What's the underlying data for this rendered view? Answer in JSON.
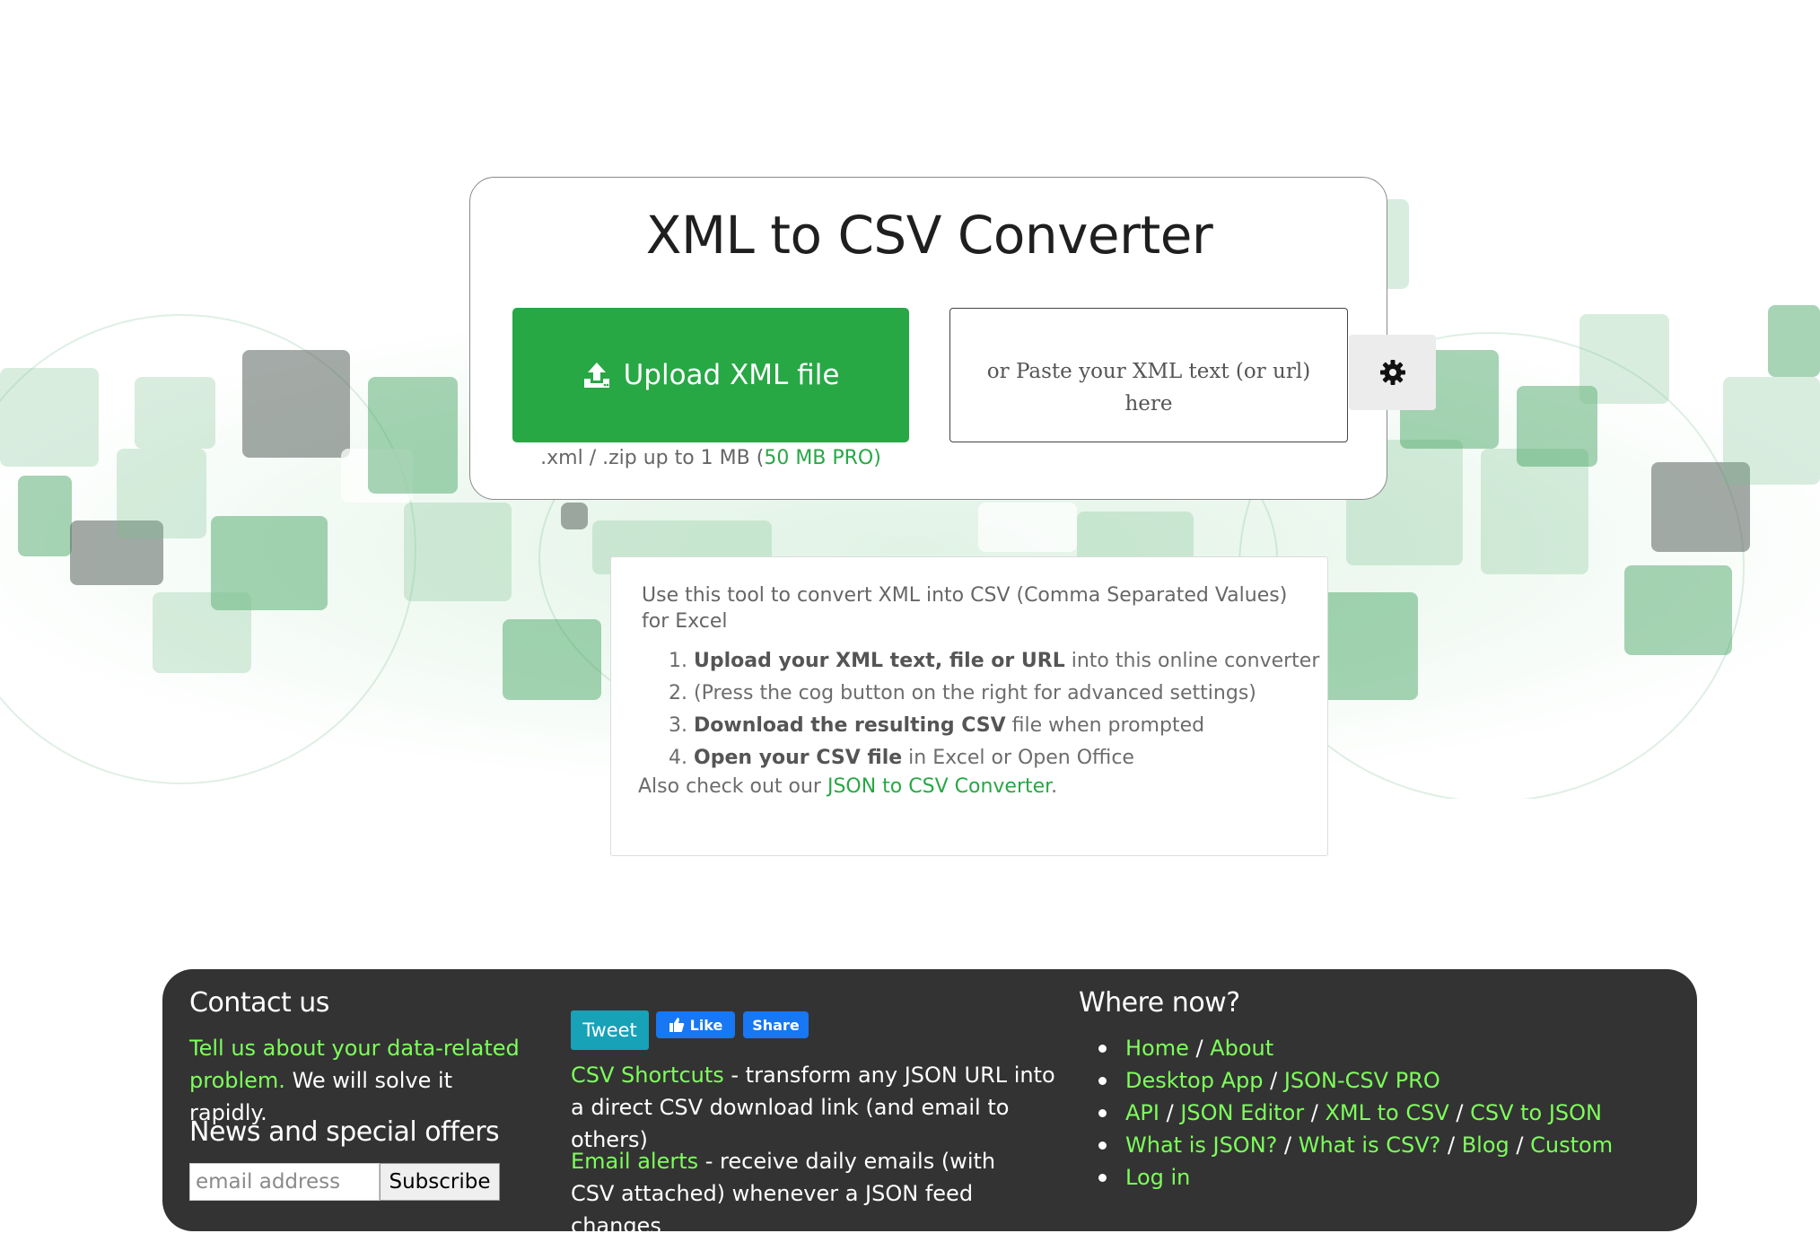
{
  "page": {
    "title": "XML to CSV Converter"
  },
  "converter": {
    "upload_label": "Upload XML file",
    "upload_note_prefix": ".xml / .zip up to 1 MB (",
    "upload_note_pro": "50 MB PRO)",
    "paste_placeholder": "or Paste your XML text (or url) here",
    "settings_icon": "gear-icon"
  },
  "info": {
    "intro": "Use this tool to convert XML into CSV (Comma Separated Values) for Excel",
    "steps": [
      {
        "bold": "Upload your XML text, file or URL",
        "rest": " into this online converter"
      },
      {
        "bold": "",
        "rest": "(Press the cog button on the right for advanced settings)"
      },
      {
        "bold": "Download the resulting CSV",
        "rest": " file when prompted"
      },
      {
        "bold": "Open your CSV file",
        "rest": " in Excel or Open Office"
      }
    ],
    "also_prefix": "Also check out our ",
    "also_link": "JSON to CSV Converter",
    "also_suffix": "."
  },
  "footer": {
    "contact_heading": "Contact us",
    "contact_link": "Tell us about your data-related problem.",
    "contact_text": " We will solve it rapidly.",
    "news_heading": "News and special offers",
    "email_placeholder": "email address",
    "subscribe_label": "Subscribe",
    "tweet_label": "Tweet",
    "fb_like_label": "Like",
    "fb_share_label": "Share",
    "shortcuts_link": "CSV Shortcuts",
    "shortcuts_text": " - transform any JSON URL into a direct CSV download link (and email to others)",
    "alerts_link": "Email alerts",
    "alerts_text": " - receive daily emails (with CSV attached) whenever a JSON feed changes",
    "where_heading": "Where now?",
    "nav": {
      "home": "Home",
      "about": "About",
      "desktop_app": "Desktop App",
      "json_csv_pro": "JSON-CSV PRO",
      "api": "API",
      "json_editor": "JSON Editor",
      "xml_to_csv": "XML to CSV",
      "csv_to_json": "CSV to JSON",
      "what_is_json": "What is JSON?",
      "what_is_csv": "What is CSV?",
      "blog": "Blog",
      "custom": "Custom",
      "log_in": "Log in",
      "sep": " / "
    }
  },
  "colors": {
    "brand_green": "#28a745",
    "footer_bg": "#333333",
    "footer_link": "#7dff5a",
    "facebook_blue": "#1877f2",
    "tweet_teal": "#17a2b8"
  }
}
